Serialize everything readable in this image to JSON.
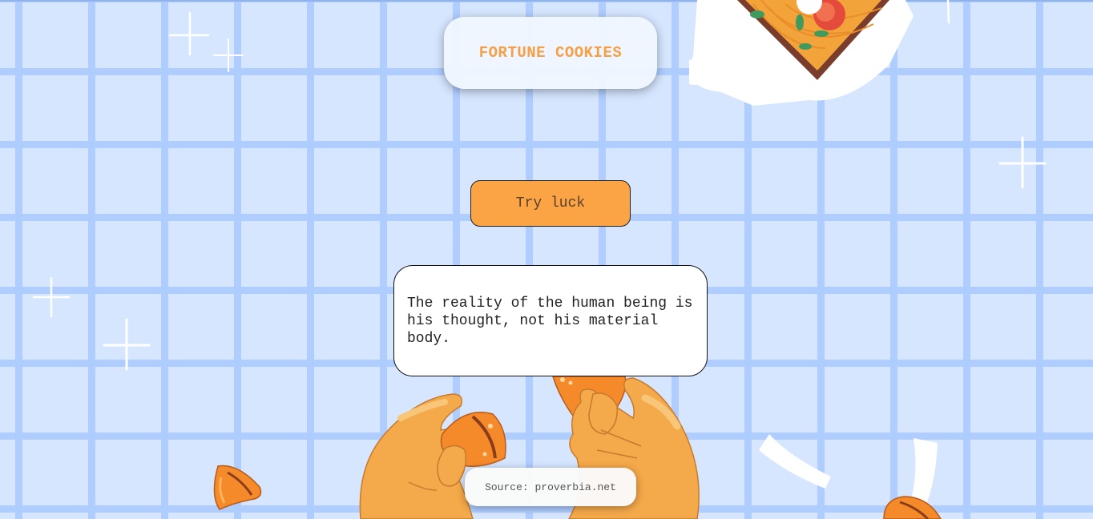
{
  "header": {
    "title": "FORTUNE COOKIES"
  },
  "actions": {
    "try_luck_label": "Try luck"
  },
  "fortune": {
    "text": "The reality of the human being is his thought, not his material body."
  },
  "footer": {
    "source": "Source: proverbia.net"
  },
  "colors": {
    "accent": "#fba445",
    "title": "#f5a046",
    "background": "#d6e6ff",
    "grid": "#adccff"
  },
  "decorations": [
    "sparkle-icon",
    "noodle-box-illustration",
    "hands-breaking-cookie-illustration",
    "fortune-cookie-icon",
    "paper-strip-icon"
  ]
}
